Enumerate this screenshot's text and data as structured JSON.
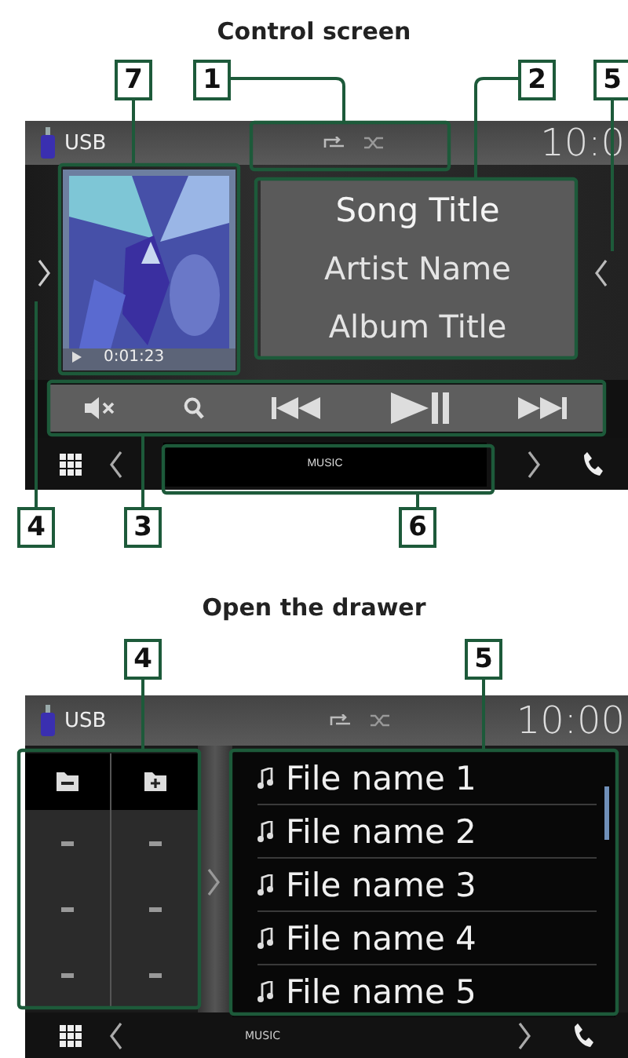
{
  "control_section": {
    "heading": "Control screen",
    "screen": {
      "source": "USB",
      "clock": "10:0",
      "elapsed": "0:01:23",
      "song_title": "Song Title",
      "artist_name": "Artist Name",
      "album_title": "Album Title",
      "source_button": "MUSIC"
    },
    "callouts": [
      "7",
      "1",
      "2",
      "5",
      "4",
      "3",
      "6"
    ]
  },
  "drawer_section": {
    "heading": "Open the drawer",
    "screen": {
      "source": "USB",
      "clock": "10:00",
      "source_label": "MUSIC",
      "files": [
        {
          "name": "File name 1"
        },
        {
          "name": "File name 2"
        },
        {
          "name": "File name 3"
        },
        {
          "name": "File name 4"
        },
        {
          "name": "File name 5"
        }
      ]
    },
    "callouts": [
      "4",
      "5"
    ]
  }
}
